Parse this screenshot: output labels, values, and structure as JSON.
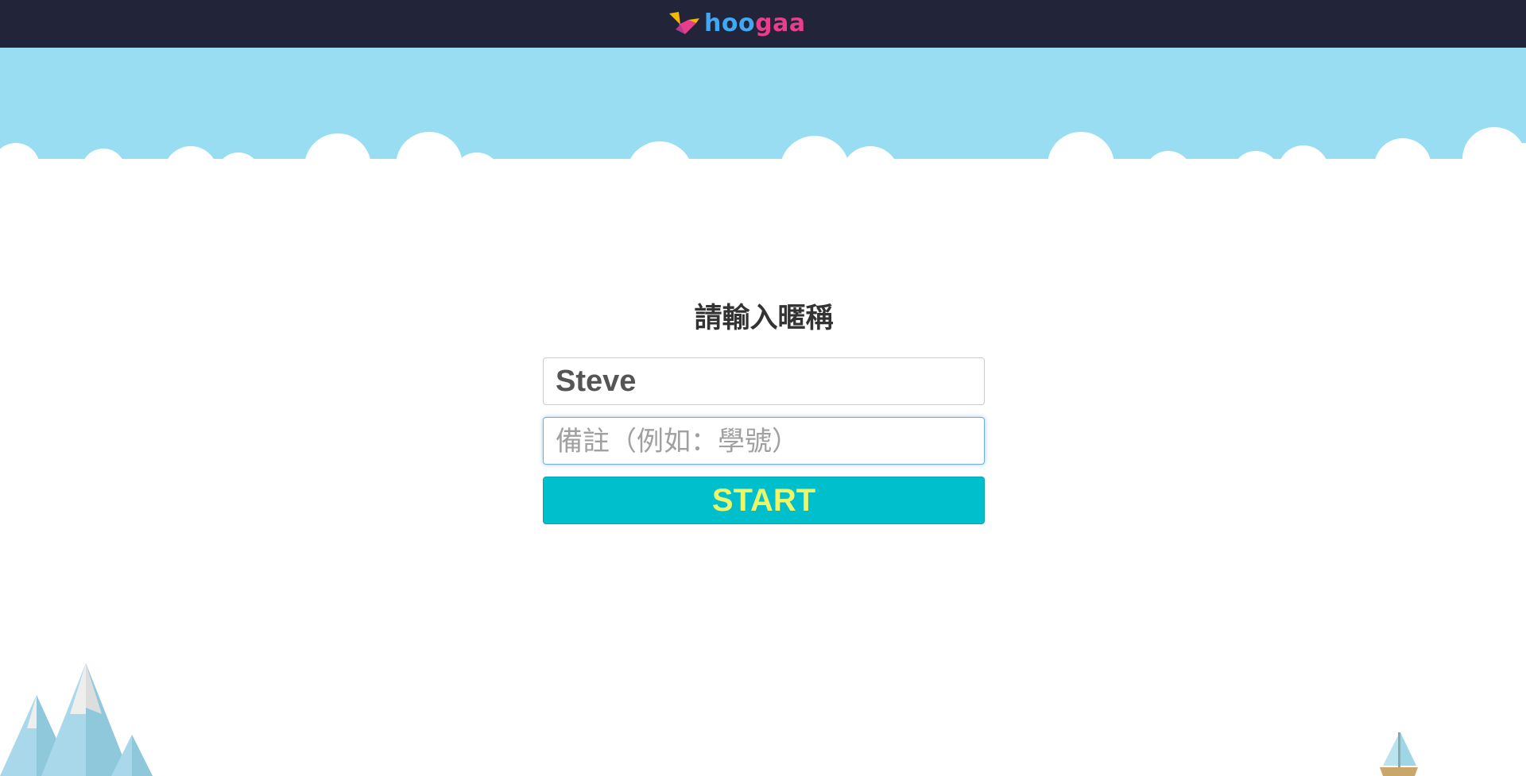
{
  "header": {
    "logo_alt": "hoogaa",
    "logo_parts": [
      "h",
      "oo",
      "g",
      "aa"
    ],
    "background_color": "#22253a"
  },
  "scene": {
    "sky_color": "#98ddf2",
    "cloud_color": "#ffffff"
  },
  "form": {
    "title": "請輸入暱稱",
    "nickname_value": "Steve",
    "note_placeholder": "備註（例如：學號）",
    "note_value": "",
    "start_label": "START",
    "start_bg": "#00bfcd",
    "start_text_color": "#eaf76a"
  },
  "decorations": {
    "mountains_icon": "snowy-mountains-icon",
    "boat_icon": "sailboat-icon"
  }
}
